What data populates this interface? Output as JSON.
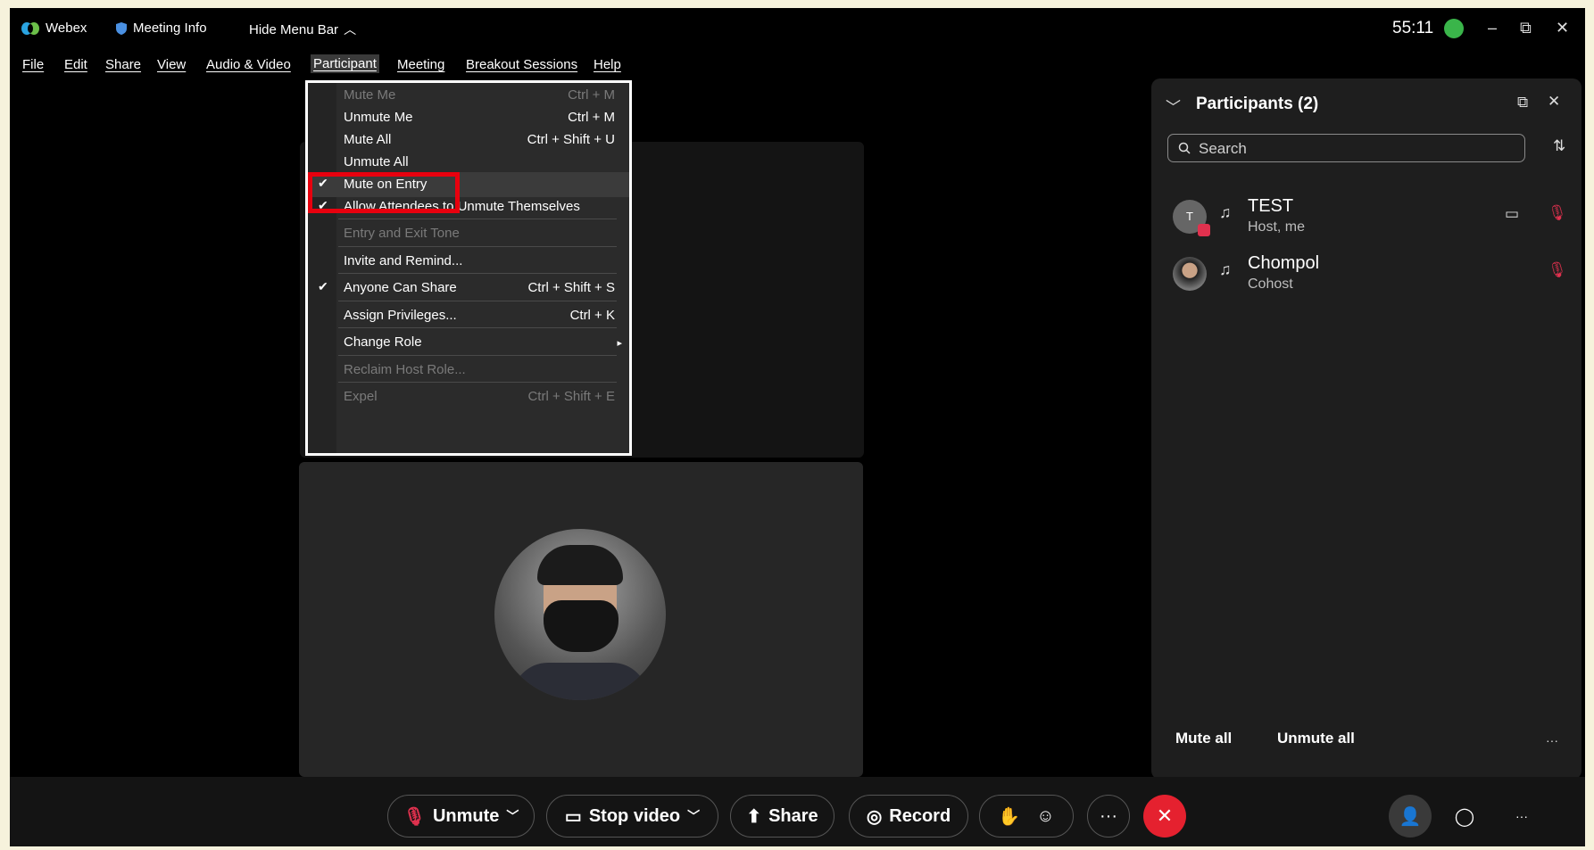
{
  "titlebar": {
    "app_name": "Webex",
    "meeting_info": "Meeting Info",
    "hide_menu_bar": "Hide Menu Bar",
    "timer": "55:11",
    "minimize": "–",
    "restore": "⧉",
    "close": "✕"
  },
  "menubar": {
    "file": "File",
    "edit": "Edit",
    "share": "Share",
    "view": "View",
    "audio_video": "Audio & Video",
    "participant": "Participant",
    "meeting": "Meeting",
    "breakout": "Breakout Sessions",
    "help": "Help"
  },
  "participant_menu": {
    "items": [
      {
        "label": "Mute Me",
        "shortcut": "Ctrl + M",
        "disabled": true,
        "checked": false
      },
      {
        "label": "Unmute Me",
        "shortcut": "Ctrl + M",
        "disabled": false,
        "checked": false
      },
      {
        "label": "Mute All",
        "shortcut": "Ctrl + Shift + U",
        "disabled": false,
        "checked": false
      },
      {
        "label": "Unmute All",
        "shortcut": "",
        "disabled": false,
        "checked": false
      },
      {
        "label": "Mute on Entry",
        "shortcut": "",
        "disabled": false,
        "checked": true
      },
      {
        "label": "Allow Attendees to Unmute Themselves",
        "shortcut": "",
        "disabled": false,
        "checked": true
      },
      {
        "label": "Entry and Exit Tone",
        "shortcut": "",
        "disabled": true,
        "checked": false
      },
      {
        "label": "Invite and Remind...",
        "shortcut": "",
        "disabled": false,
        "checked": false
      },
      {
        "label": "Anyone Can Share",
        "shortcut": "Ctrl + Shift + S",
        "disabled": false,
        "checked": true
      },
      {
        "label": "Assign Privileges...",
        "shortcut": "Ctrl + K",
        "disabled": false,
        "checked": false
      },
      {
        "label": "Change Role",
        "shortcut": "▸",
        "disabled": false,
        "checked": false
      },
      {
        "label": "Reclaim Host Role...",
        "shortcut": "",
        "disabled": true,
        "checked": false
      },
      {
        "label": "Expel",
        "shortcut": "Ctrl + Shift + E",
        "disabled": true,
        "checked": false
      }
    ],
    "check_glyph": "✔"
  },
  "participants_panel": {
    "title": "Participants (2)",
    "search_placeholder": "Search",
    "participants": [
      {
        "name": "TEST",
        "role": "Host, me",
        "initial": "T"
      },
      {
        "name": "Chompol",
        "role": "Cohost",
        "initial": ""
      }
    ],
    "mute_all": "Mute all",
    "unmute_all": "Unmute all",
    "more": "···"
  },
  "controls": {
    "unmute": "Unmute",
    "stop_video": "Stop video",
    "share": "Share",
    "record": "Record",
    "more": "···",
    "overflow": "···"
  },
  "colors": {
    "highlight_box": "#e8000e",
    "end_call": "#e5212f",
    "mute_red": "#e0314e",
    "status_green": "#3ab54a"
  }
}
